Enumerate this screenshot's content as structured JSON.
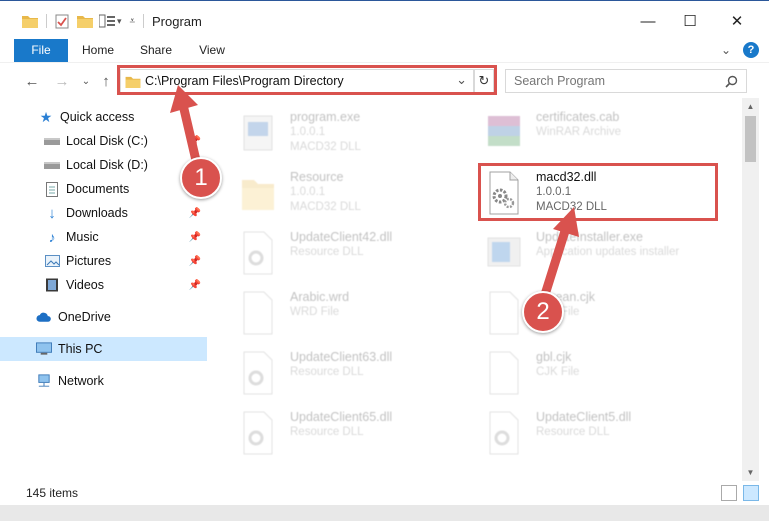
{
  "window": {
    "title": "Program",
    "minimize": "—",
    "maximize": "☐",
    "close": "✕"
  },
  "ribbon": {
    "tabs": [
      "File",
      "Home",
      "Share",
      "View"
    ],
    "expand": "⌄",
    "help": "?"
  },
  "address": {
    "path": "C:\\Program Files\\Program Directory",
    "dropdown": "⌄",
    "refresh": "↻"
  },
  "search": {
    "placeholder": "Search Program",
    "icon": "search-icon"
  },
  "nav": {
    "back": "←",
    "forward": "→",
    "recent": "⌄",
    "up": "↑",
    "items": [
      {
        "label": "Quick access",
        "icon": "star-icon",
        "pinned": false
      },
      {
        "label": "Local Disk (C:)",
        "icon": "drive-icon",
        "pinned": true
      },
      {
        "label": "Local Disk (D:)",
        "icon": "drive-icon",
        "pinned": true
      },
      {
        "label": "Documents",
        "icon": "document-icon",
        "pinned": true
      },
      {
        "label": "Downloads",
        "icon": "download-icon",
        "pinned": true
      },
      {
        "label": "Music",
        "icon": "music-icon",
        "pinned": true
      },
      {
        "label": "Pictures",
        "icon": "picture-icon",
        "pinned": true
      },
      {
        "label": "Videos",
        "icon": "video-icon",
        "pinned": true
      },
      {
        "label": "OneDrive",
        "icon": "cloud-icon",
        "pinned": false
      },
      {
        "label": "This PC",
        "icon": "computer-icon",
        "pinned": false
      },
      {
        "label": "Network",
        "icon": "network-icon",
        "pinned": false
      }
    ]
  },
  "files": [
    {
      "name": "program.exe",
      "meta1": "1.0.0.1",
      "meta2": "MACD32 DLL",
      "icon": "exe-icon"
    },
    {
      "name": "certificates.cab",
      "meta1": "WinRAR Archive",
      "meta2": "",
      "icon": "archive-icon"
    },
    {
      "name": "Resource",
      "meta1": "1.0.0.1",
      "meta2": "MACD32 DLL",
      "icon": "folder-icon"
    },
    {
      "name": "macd32.dll",
      "meta1": "1.0.0.1",
      "meta2": "MACD32 DLL",
      "icon": "dll-gear-icon"
    },
    {
      "name": "UpdateClient42.dll",
      "meta1": "Resource DLL",
      "meta2": "",
      "icon": "dll-icon"
    },
    {
      "name": "UpdateInstaller.exe",
      "meta1": "Application updates installer",
      "meta2": "",
      "icon": "installer-icon"
    },
    {
      "name": "Arabic.wrd",
      "meta1": "WRD File",
      "meta2": "",
      "icon": "file-icon"
    },
    {
      "name": "Korean.cjk",
      "meta1": "CJK File",
      "meta2": "",
      "icon": "file-icon"
    },
    {
      "name": "UpdateClient63.dll",
      "meta1": "Resource DLL",
      "meta2": "",
      "icon": "dll-icon"
    },
    {
      "name": "gbl.cjk",
      "meta1": "CJK File",
      "meta2": "",
      "icon": "file-icon"
    },
    {
      "name": "UpdateClient65.dll",
      "meta1": "Resource DLL",
      "meta2": "",
      "icon": "dll-icon"
    },
    {
      "name": "UpdateClient5.dll",
      "meta1": "Resource DLL",
      "meta2": "",
      "icon": "dll-icon"
    }
  ],
  "status": {
    "count": "145 items"
  },
  "callouts": [
    "1",
    "2"
  ],
  "colors": {
    "accent": "#1979ca",
    "highlight": "#d9524e",
    "selection": "#cce8ff"
  }
}
